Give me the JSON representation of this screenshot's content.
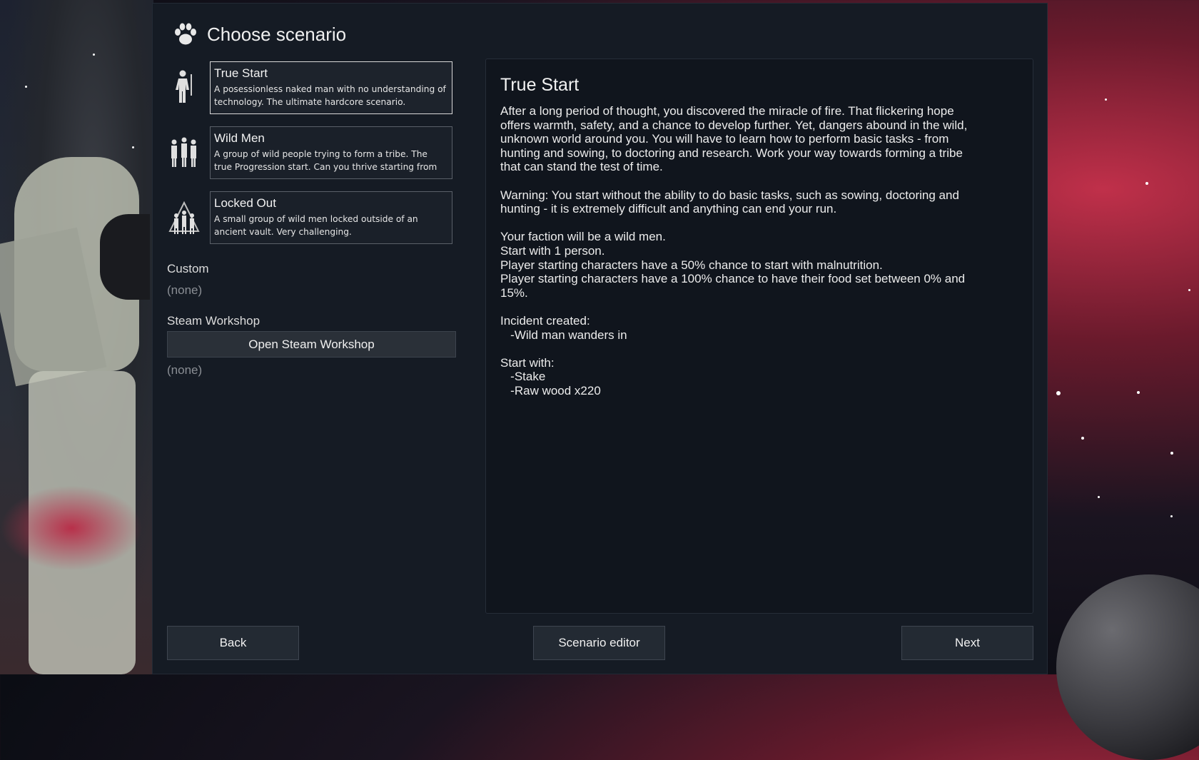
{
  "dialog": {
    "title": "Choose scenario"
  },
  "scenarios": [
    {
      "name": "True Start",
      "description": "A posessionless naked man with no understanding of technology. The ultimate hardcore scenario.",
      "icon": "single-man-icon",
      "selected": true
    },
    {
      "name": "Wild Men",
      "description": "A group of wild people trying to form a tribe. The true Progression start. Can you thrive starting from",
      "icon": "wild-group-icon",
      "selected": false
    },
    {
      "name": "Locked Out",
      "description": "A small group of wild men locked outside of an ancient vault. Very challenging.",
      "icon": "locked-group-icon",
      "selected": false
    }
  ],
  "custom": {
    "label": "Custom",
    "value": "(none)"
  },
  "workshop": {
    "label": "Steam Workshop",
    "button_label": "Open Steam Workshop",
    "value": "(none)"
  },
  "detail": {
    "title": "True Start",
    "body": "After a long period of thought, you discovered the miracle of fire. That flickering hope\noffers warmth, safety, and a chance to develop further. Yet, dangers abound in the wild,\nunknown world around you. You will have to learn how to perform basic tasks - from\nhunting and sowing, to doctoring and research. Work your way towards forming a tribe\nthat can stand the test of time.\n\nWarning: You start without the ability to do basic tasks, such as sowing, doctoring and\nhunting - it is extremely difficult and anything can end your run.\n\nYour faction will be a wild men.\nStart with 1 person.\nPlayer starting characters have a 50% chance to start with malnutrition.\nPlayer starting characters have a 100% chance to have their food set between 0% and\n15%.\n\nIncident created:\n   -Wild man wanders in\n\nStart with:\n   -Stake\n   -Raw wood x220"
  },
  "buttons": {
    "back": "Back",
    "editor": "Scenario editor",
    "next": "Next"
  },
  "colors": {
    "panel": "#151b24",
    "detail_panel": "#10151d",
    "button": "#232a33",
    "selected_border": "#d8d8d8"
  }
}
